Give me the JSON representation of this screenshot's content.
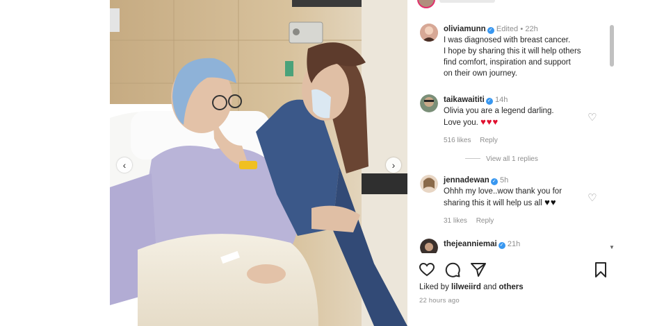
{
  "post": {
    "liked_by_prefix": "Liked by",
    "liked_by_user": "lilweiird",
    "liked_by_suffix": "and",
    "liked_by_others": "others",
    "time_ago": "22 hours ago"
  },
  "comments": [
    {
      "username": "oliviamunn",
      "verified": true,
      "edited": "Edited",
      "separator": "•",
      "time": "22h",
      "lines": [
        "I was diagnosed with breast cancer.",
        "I hope by sharing this it will help others",
        "find comfort, inspiration and support",
        "on their own journey."
      ]
    },
    {
      "username": "taikawaititi",
      "verified": true,
      "time": "14h",
      "lines": [
        "Olivia you are a legend darling.",
        "Love you."
      ],
      "hearts": "♥♥♥",
      "likes": "516 likes",
      "reply": "Reply",
      "view_replies": "View all 1 replies"
    },
    {
      "username": "jennadewan",
      "verified": true,
      "time": "5h",
      "lines": [
        "Ohhh my love..wow thank you for",
        "sharing this it will help us all"
      ],
      "hearts": "♥♥",
      "likes": "31 likes",
      "reply": "Reply"
    },
    {
      "username": "thejeanniemai",
      "verified": true,
      "time": "21h"
    }
  ],
  "icons": {
    "like": "heart-outline-icon",
    "comment": "comment-bubble-icon",
    "share": "paper-plane-icon",
    "save": "bookmark-icon"
  },
  "colors": {
    "verified": "#3897f0",
    "heart_emoji": "#e0102f",
    "muted_text": "#8e8e8e",
    "gown": "#b7b2d6",
    "scrub": "#3c5a8c"
  }
}
